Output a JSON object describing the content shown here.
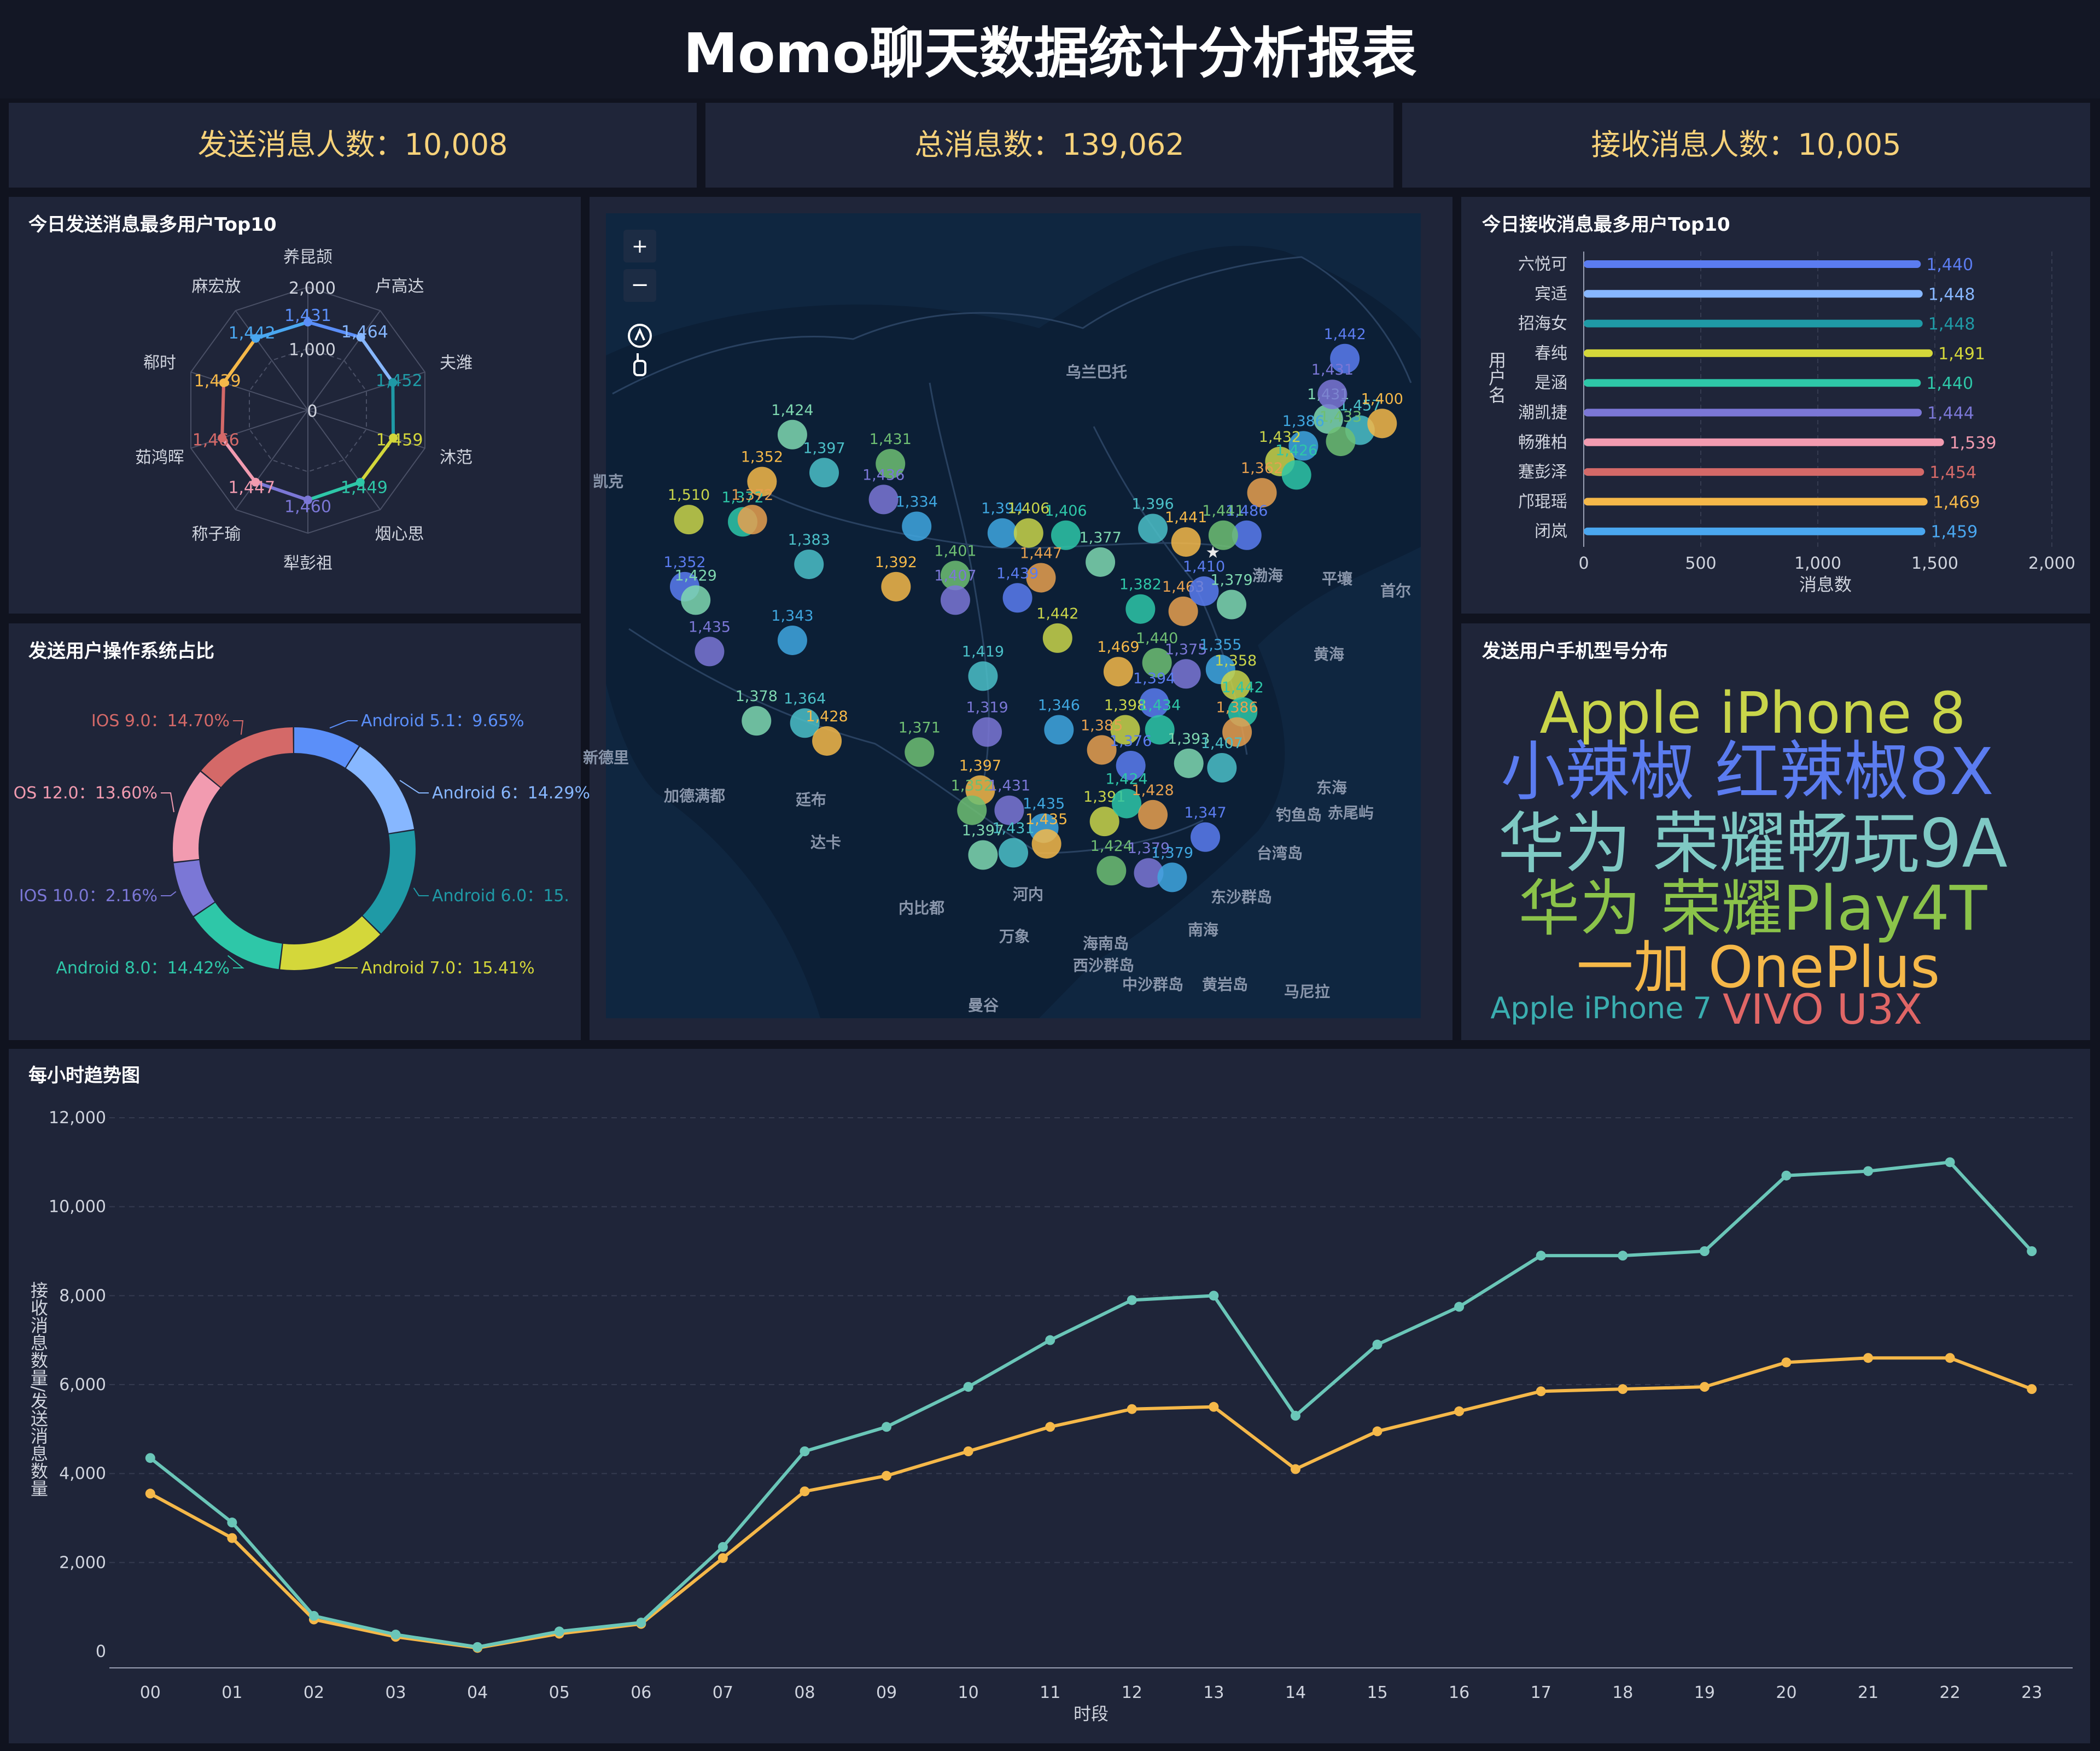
{
  "page": {
    "title": "Momo聊天数据统计分析报表"
  },
  "kpis": [
    {
      "label": "发送消息人数：",
      "value": "10,008"
    },
    {
      "label": "总消息数：",
      "value": "139,062"
    },
    {
      "label": "接收消息人数：",
      "value": "10,005"
    }
  ],
  "colors": {
    "background": "#10131f",
    "panel": "#1f2539",
    "kpi_text": "#f7d27a",
    "axis_text": "#c8ccd8",
    "line_receive": "#6ac6b8",
    "line_send": "#f5b849",
    "palette": [
      "#5b8ff9",
      "#87b7ff",
      "#1f9aa6",
      "#d4d73a",
      "#2ec7a8",
      "#7b77d6",
      "#f29bb0",
      "#d46968",
      "#f5b849",
      "#4aa7f0",
      "#6fbf73",
      "#4bc0c8"
    ]
  },
  "map_controls": {
    "zoom_in": "+",
    "zoom_out": "−",
    "icons": [
      "reset-view-icon",
      "pan-hand-icon"
    ]
  },
  "chart_data": [
    {
      "id": "radar",
      "type": "radar",
      "title": "今日发送消息最多用户Top10",
      "indicators": [
        "养昆颉",
        "卢高达",
        "夫潍",
        "沐范",
        "烟心思",
        "犁彭祖",
        "称子瑜",
        "茹鸿晖",
        "郗时",
        "麻宏放"
      ],
      "values": [
        1431,
        1464,
        1452,
        1459,
        1449,
        1460,
        1447,
        1466,
        1439,
        1442
      ],
      "max": 2000,
      "ticks": [
        "0",
        "1,000",
        "2,000"
      ]
    },
    {
      "id": "hbar",
      "type": "bar",
      "orientation": "horizontal",
      "title": "今日接收消息最多用户Top10",
      "categories": [
        "六悦可",
        "宾适",
        "招海女",
        "春纯",
        "是涵",
        "潮凯捷",
        "畅雅柏",
        "蹇彭泽",
        "邝琨瑶",
        "闭岚"
      ],
      "values": [
        1440,
        1448,
        1448,
        1491,
        1440,
        1444,
        1539,
        1454,
        1469,
        1459
      ],
      "xlabel": "消息数",
      "ylabel": "用户名",
      "xlim": [
        0,
        2000
      ],
      "xticks": [
        "0",
        "500",
        "1,000",
        "1,500",
        "2,000"
      ]
    },
    {
      "id": "donut",
      "type": "pie",
      "title": "发送用户操作系统占比",
      "slices": [
        {
          "label": "Android 5.1：9.65%",
          "value": 9.65
        },
        {
          "label": "Android 6：14.29%",
          "value": 14.29
        },
        {
          "label": "Android 6.0：15.",
          "value": 15.77
        },
        {
          "label": "Android 7.0：15.41%",
          "value": 15.41
        },
        {
          "label": "Android 8.0：14.42%",
          "value": 14.42
        },
        {
          "label": "IOS 10.0：2.16%",
          "value": 8.08
        },
        {
          "label": "OS 12.0：13.60%",
          "value": 13.6
        },
        {
          "label": "IOS 9.0：14.70%",
          "value": 14.7
        }
      ]
    },
    {
      "id": "wordcloud",
      "type": "wordcloud",
      "title": "发送用户手机型号分布",
      "words": [
        {
          "text": "Apple iPhone 8",
          "weight": 1.0
        },
        {
          "text": "小辣椒 红辣椒8X",
          "weight": 1.0
        },
        {
          "text": "华为 荣耀畅玩9A",
          "weight": 1.0
        },
        {
          "text": "华为 荣耀Play4T",
          "weight": 1.0
        },
        {
          "text": "一加 OnePlus",
          "weight": 1.0
        },
        {
          "text": "Apple iPhone 7",
          "weight": 0.45
        },
        {
          "text": "VIVO U3X",
          "weight": 0.65
        }
      ]
    },
    {
      "id": "map",
      "type": "scatter",
      "title": "",
      "place_labels": [
        "乌兰巴托",
        "平壤",
        "首尔",
        "渤海",
        "黄海",
        "东海",
        "钓鱼岛",
        "赤尾屿",
        "台湾岛",
        "东沙群岛",
        "南海",
        "西沙群岛",
        "中沙群岛",
        "黄岩岛",
        "马尼拉",
        "新德里",
        "加德满都",
        "廷布",
        "达卡",
        "内比都",
        "河内",
        "万象",
        "曼谷",
        "海南岛",
        "凯克"
      ],
      "points": [
        {
          "lon": 128.5,
          "lat": 47.5,
          "value": 1442
        },
        {
          "lon": 127.3,
          "lat": 44.8,
          "value": 1431
        },
        {
          "lon": 129.6,
          "lat": 44.3,
          "value": 1457
        },
        {
          "lon": 131.2,
          "lat": 44.6,
          "value": 1400
        },
        {
          "lon": 128.2,
          "lat": 43.8,
          "value": 1433
        },
        {
          "lon": 127.6,
          "lat": 45.9,
          "value": 1431
        },
        {
          "lon": 125.5,
          "lat": 43.6,
          "value": 1386
        },
        {
          "lon": 123.8,
          "lat": 42.9,
          "value": 1432
        },
        {
          "lon": 125.0,
          "lat": 42.3,
          "value": 1426
        },
        {
          "lon": 122.5,
          "lat": 41.5,
          "value": 1362
        },
        {
          "lon": 121.4,
          "lat": 39.6,
          "value": 1486
        },
        {
          "lon": 88.5,
          "lat": 44.1,
          "value": 1424
        },
        {
          "lon": 90.8,
          "lat": 42.4,
          "value": 1397
        },
        {
          "lon": 86.3,
          "lat": 42.0,
          "value": 1352
        },
        {
          "lon": 95.6,
          "lat": 42.8,
          "value": 1431
        },
        {
          "lon": 95.1,
          "lat": 41.2,
          "value": 1436
        },
        {
          "lon": 97.5,
          "lat": 40.0,
          "value": 1334
        },
        {
          "lon": 81.0,
          "lat": 40.3,
          "value": 1510
        },
        {
          "lon": 84.9,
          "lat": 40.2,
          "value": 1372
        },
        {
          "lon": 85.6,
          "lat": 40.3,
          "value": 1372
        },
        {
          "lon": 80.7,
          "lat": 37.3,
          "value": 1352
        },
        {
          "lon": 81.5,
          "lat": 36.7,
          "value": 1429
        },
        {
          "lon": 89.7,
          "lat": 38.3,
          "value": 1383
        },
        {
          "lon": 96.0,
          "lat": 37.3,
          "value": 1392
        },
        {
          "lon": 100.3,
          "lat": 37.8,
          "value": 1401
        },
        {
          "lon": 100.3,
          "lat": 36.7,
          "value": 1407
        },
        {
          "lon": 103.7,
          "lat": 39.7,
          "value": 1394
        },
        {
          "lon": 105.6,
          "lat": 39.7,
          "value": 1406
        },
        {
          "lon": 108.3,
          "lat": 39.6,
          "value": 1406
        },
        {
          "lon": 106.5,
          "lat": 37.7,
          "value": 1447
        },
        {
          "lon": 104.8,
          "lat": 36.8,
          "value": 1439
        },
        {
          "lon": 110.8,
          "lat": 38.4,
          "value": 1377
        },
        {
          "lon": 114.6,
          "lat": 39.9,
          "value": 1396
        },
        {
          "lon": 117.0,
          "lat": 39.3,
          "value": 1441
        },
        {
          "lon": 119.7,
          "lat": 39.6,
          "value": 1441
        },
        {
          "lon": 82.5,
          "lat": 34.4,
          "value": 1435
        },
        {
          "lon": 88.5,
          "lat": 34.9,
          "value": 1343
        },
        {
          "lon": 107.7,
          "lat": 35.0,
          "value": 1442
        },
        {
          "lon": 113.7,
          "lat": 36.3,
          "value": 1382
        },
        {
          "lon": 116.8,
          "lat": 36.2,
          "value": 1463
        },
        {
          "lon": 118.3,
          "lat": 37.1,
          "value": 1410
        },
        {
          "lon": 120.3,
          "lat": 36.5,
          "value": 1379
        },
        {
          "lon": 102.3,
          "lat": 33.3,
          "value": 1419
        },
        {
          "lon": 112.1,
          "lat": 33.5,
          "value": 1469
        },
        {
          "lon": 114.9,
          "lat": 33.9,
          "value": 1440
        },
        {
          "lon": 117.0,
          "lat": 33.4,
          "value": 1375
        },
        {
          "lon": 119.5,
          "lat": 33.6,
          "value": 1355
        },
        {
          "lon": 120.6,
          "lat": 32.9,
          "value": 1358
        },
        {
          "lon": 121.1,
          "lat": 31.7,
          "value": 1442
        },
        {
          "lon": 120.7,
          "lat": 30.8,
          "value": 1386
        },
        {
          "lon": 114.7,
          "lat": 32.1,
          "value": 1394
        },
        {
          "lon": 85.9,
          "lat": 31.3,
          "value": 1378
        },
        {
          "lon": 89.4,
          "lat": 31.2,
          "value": 1364
        },
        {
          "lon": 91.0,
          "lat": 30.4,
          "value": 1428
        },
        {
          "lon": 97.7,
          "lat": 29.9,
          "value": 1371
        },
        {
          "lon": 102.6,
          "lat": 30.8,
          "value": 1319
        },
        {
          "lon": 107.8,
          "lat": 30.9,
          "value": 1346
        },
        {
          "lon": 112.6,
          "lat": 30.9,
          "value": 1398
        },
        {
          "lon": 115.1,
          "lat": 30.9,
          "value": 1434
        },
        {
          "lon": 110.9,
          "lat": 30.0,
          "value": 1385
        },
        {
          "lon": 113.0,
          "lat": 29.3,
          "value": 1376
        },
        {
          "lon": 117.2,
          "lat": 29.4,
          "value": 1393
        },
        {
          "lon": 119.6,
          "lat": 29.2,
          "value": 1407
        },
        {
          "lon": 102.1,
          "lat": 28.2,
          "value": 1397
        },
        {
          "lon": 101.5,
          "lat": 27.3,
          "value": 1352
        },
        {
          "lon": 104.2,
          "lat": 27.3,
          "value": 1431
        },
        {
          "lon": 106.7,
          "lat": 26.5,
          "value": 1435
        },
        {
          "lon": 111.1,
          "lat": 26.8,
          "value": 1391
        },
        {
          "lon": 112.7,
          "lat": 27.6,
          "value": 1424
        },
        {
          "lon": 114.6,
          "lat": 27.1,
          "value": 1428
        },
        {
          "lon": 118.4,
          "lat": 26.1,
          "value": 1347
        },
        {
          "lon": 102.3,
          "lat": 25.3,
          "value": 1397
        },
        {
          "lon": 104.5,
          "lat": 25.4,
          "value": 1431
        },
        {
          "lon": 106.9,
          "lat": 25.8,
          "value": 1435
        },
        {
          "lon": 111.6,
          "lat": 24.6,
          "value": 1424
        },
        {
          "lon": 114.3,
          "lat": 24.5,
          "value": 1379
        },
        {
          "lon": 116.0,
          "lat": 24.3,
          "value": 1379
        }
      ]
    },
    {
      "id": "trend",
      "type": "line",
      "title": "每小时趋势图",
      "categories": [
        "00",
        "01",
        "02",
        "03",
        "04",
        "05",
        "06",
        "07",
        "08",
        "09",
        "10",
        "11",
        "12",
        "13",
        "14",
        "15",
        "16",
        "17",
        "18",
        "19",
        "20",
        "21",
        "22",
        "23"
      ],
      "series": [
        {
          "name": "",
          "values": [
            4350,
            2900,
            800,
            380,
            100,
            450,
            650,
            2350,
            4500,
            5050,
            5950,
            7000,
            7900,
            8000,
            5300,
            6900,
            7750,
            8900,
            8900,
            9000,
            10700,
            10800,
            11000,
            9000
          ]
        },
        {
          "name": "",
          "values": [
            3550,
            2550,
            720,
            330,
            80,
            400,
            620,
            2100,
            3600,
            3950,
            4500,
            5050,
            5450,
            5500,
            4100,
            4950,
            5400,
            5850,
            5900,
            5950,
            6500,
            6600,
            6600,
            5900
          ]
        }
      ],
      "xlabel": "时段",
      "ylabel": "接收消息数量/发送消息数量",
      "ylim": [
        0,
        12000
      ],
      "yticks": [
        "0",
        "2,000",
        "4,000",
        "6,000",
        "8,000",
        "10,000",
        "12,000"
      ]
    }
  ]
}
